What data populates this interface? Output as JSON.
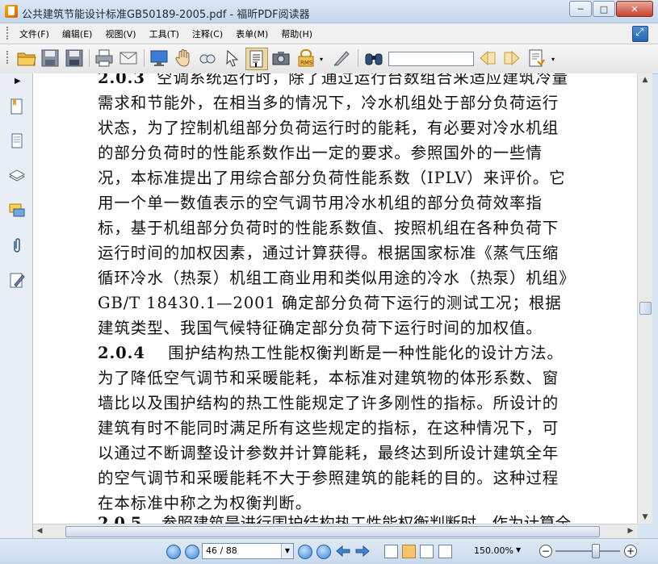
{
  "window": {
    "title": "公共建筑节能设计标准GB50189-2005.pdf - 福昕PDF阅读器",
    "minimize": "─",
    "maximize": "□",
    "close": "✕"
  },
  "menu": {
    "items": [
      {
        "label": "文件(F)"
      },
      {
        "label": "编辑(E)"
      },
      {
        "label": "视图(V)"
      },
      {
        "label": "工具(T)"
      },
      {
        "label": "注释(C)"
      },
      {
        "label": "表单(M)"
      },
      {
        "label": "帮助(H)"
      }
    ]
  },
  "toolbar": {
    "find_value": ""
  },
  "document": {
    "paragraphs": [
      {
        "num": "2.0.3",
        "text": "空调系统运行时，除了通过运行台数组合来适应建筑冷量需求和节能外，在相当多的情况下，冷水机组处于部分负荷运行状态，为了控制机组部分负荷运行时的能耗，有必要对冷水机组的部分负荷时的性能系数作出一定的要求。参照国外的一些情况，本标准提出了用综合部分负荷性能系数（IPLV）来评价。它用一个单一数值表示的空气调节用冷水机组的部分负荷效率指标，基于机组部分负荷时的性能系数值、按照机组在各种负荷下运行时间的加权因素，通过计算获得。根据国家标准《蒸气压缩循环冷水（热泵）机组工商业用和类似用途的冷水（热泵）机组》GB/T 18430.1—2001 确定部分负荷下运行的测试工况；根据建筑类型、我国气候特征确定部分负荷下运行时间的加权值。"
      },
      {
        "num": "2.0.4",
        "text": "围护结构热工性能权衡判断是一种性能化的设计方法。为了降低空气调节和采暖能耗，本标准对建筑物的体形系数、窗墙比以及围护结构的热工性能规定了许多刚性的指标。所设计的建筑有时不能同时满足所有这些规定的指标，在这种情况下，可以通过不断调整设计参数并计算能耗，最终达到所设计建筑全年的空气调节和采暖能耗不大于参照建筑的能耗的目的。这种过程在本标准中称之为权衡判断。"
      },
      {
        "num": "2.0.5",
        "text": "参照建筑是进行围护结构热工性能权衡判断时，作为计算全"
      }
    ]
  },
  "status": {
    "page_display": "46 / 88",
    "zoom": "150.00%",
    "zoom_level_fraction": 0.62
  }
}
